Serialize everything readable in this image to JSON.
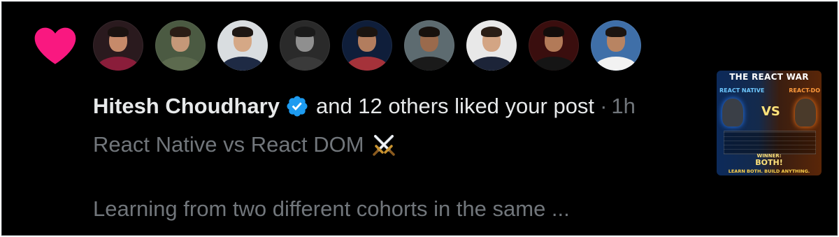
{
  "notification": {
    "liker_name": "Hitesh Choudhary",
    "action_text": "and 12 others liked your post",
    "separator": "·",
    "time_ago": "1h",
    "post_title": "React Native vs React DOM",
    "post_excerpt": "Learning from two different cohorts in the same ...",
    "heart_icon": "heart-icon",
    "verified_icon": "verified-badge-icon",
    "emoji_icon": "crossed-swords-icon",
    "colors": {
      "heart": "#f91880",
      "verified": "#1d9bf0",
      "primary_text": "#e7e9ea",
      "secondary_text": "#71767b",
      "background": "#000000"
    }
  },
  "avatars": [
    {
      "bg": "#2a1a1e",
      "skin": "#c68a6a",
      "hair": "#1a1210",
      "shirt": "#8a1d3a"
    },
    {
      "bg": "#4b5a42",
      "skin": "#c59878",
      "hair": "#2a1d15",
      "shirt": "#5c6a4e"
    },
    {
      "bg": "#d9dde0",
      "skin": "#d5a886",
      "hair": "#1e1713",
      "shirt": "#1e2a44"
    },
    {
      "bg": "#2a2a2a",
      "skin": "#8f8f8f",
      "hair": "#1a1a1a",
      "shirt": "#3a3a3a"
    },
    {
      "bg": "#0f1e3a",
      "skin": "#b27d5e",
      "hair": "#1a1410",
      "shirt": "#a5323a"
    },
    {
      "bg": "#5d6b70",
      "skin": "#9a6a4c",
      "hair": "#17110d",
      "shirt": "#1a1a1a"
    },
    {
      "bg": "#e8e8e8",
      "skin": "#d3a584",
      "hair": "#2a1e16",
      "shirt": "#1c2438"
    },
    {
      "bg": "#3a0e0e",
      "skin": "#b27a58",
      "hair": "#120c0a",
      "shirt": "#151515"
    },
    {
      "bg": "#3f6fa8",
      "skin": "#b88462",
      "hair": "#1b1410",
      "shirt": "#f2f2f2"
    }
  ],
  "thumbnail": {
    "title": "THE REACT WAR",
    "left_label": "REACT NATIVE",
    "right_label": "REACT-DO",
    "vs": "VS",
    "winner": "WINNER:",
    "both": "BOTH!",
    "footer": "LEARN BOTH. BUILD ANYTHING."
  }
}
